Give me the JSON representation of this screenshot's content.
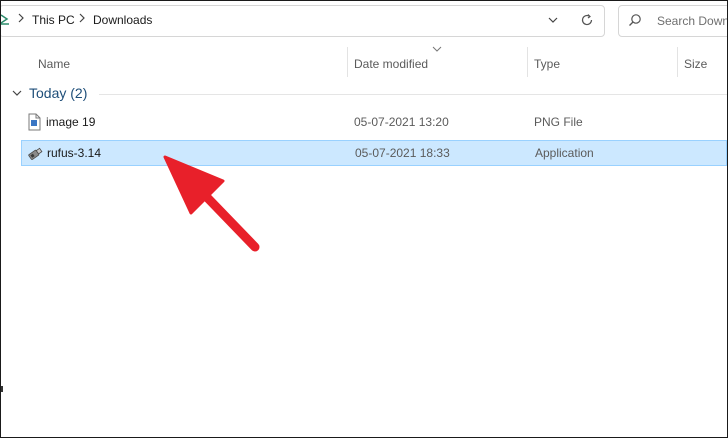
{
  "window": {
    "breadcrumb": [
      "This PC",
      "Downloads"
    ]
  },
  "search": {
    "placeholder": "Search Down"
  },
  "columns": {
    "name": "Name",
    "date_modified": "Date modified",
    "type": "Type",
    "size": "Size"
  },
  "group": {
    "label": "Today (2)"
  },
  "files": [
    {
      "name": "image 19",
      "date_modified": "05-07-2021 13:20",
      "type": "PNG File",
      "icon": "png-file-icon",
      "selected": false
    },
    {
      "name": "rufus-3.14",
      "date_modified": "05-07-2021 18:33",
      "type": "Application",
      "icon": "application-icon",
      "selected": true
    }
  ],
  "colors": {
    "selection_bg": "#cce8ff",
    "selection_border": "#99d1ff",
    "group_label": "#1e4e79",
    "annotation_arrow": "#e8202a"
  }
}
